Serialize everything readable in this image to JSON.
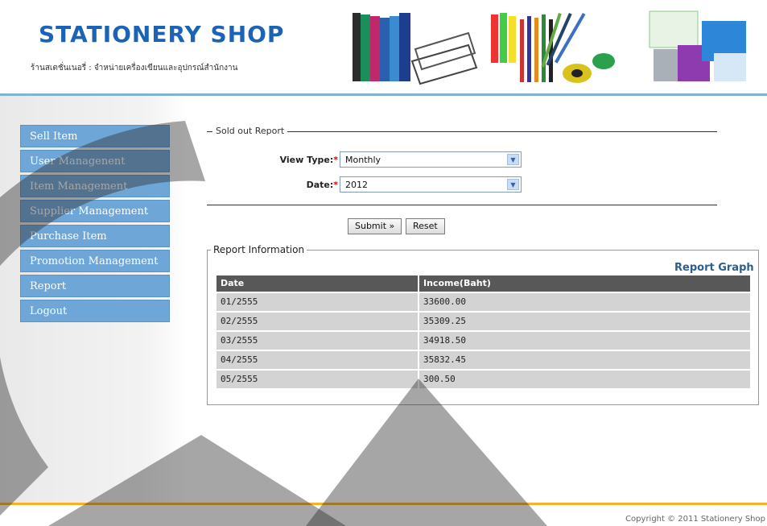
{
  "header": {
    "logo": "STATIONERY SHOP",
    "tagline": "ร้านสเตชั่นเนอรี่ : จำหน่ายเครื่องเขียนและอุปกรณ์สำนักงาน"
  },
  "nav": {
    "items": [
      {
        "label": "Sell Item"
      },
      {
        "label": "User Managenent"
      },
      {
        "label": "Item Management"
      },
      {
        "label": "Supplier Management"
      },
      {
        "label": "Purchase Item"
      },
      {
        "label": "Promotion Management"
      },
      {
        "label": "Report"
      },
      {
        "label": "Logout"
      }
    ]
  },
  "form": {
    "legend": "Sold out Report",
    "view_type_label": "View Type:",
    "view_type_value": "Monthly",
    "date_label": "Date:",
    "date_value": "2012",
    "required_mark": "*",
    "submit_label": "Submit »",
    "reset_label": "Reset"
  },
  "report": {
    "legend": "Report Information",
    "graph_link": "Report Graph",
    "columns": [
      "Date",
      "Income(Baht)"
    ],
    "rows": [
      [
        "01/2555",
        "33600.00"
      ],
      [
        "02/2555",
        "35309.25"
      ],
      [
        "03/2555",
        "34918.50"
      ],
      [
        "04/2555",
        "35832.45"
      ],
      [
        "05/2555",
        "300.50"
      ]
    ]
  },
  "footer": {
    "copyright": "Copyright © 2011 Stationery Shop"
  },
  "colors": {
    "brand_blue": "#1b63b5",
    "nav_blue": "#6ea6d8",
    "accent_orange": "#f7b02a",
    "table_header": "#585858"
  }
}
